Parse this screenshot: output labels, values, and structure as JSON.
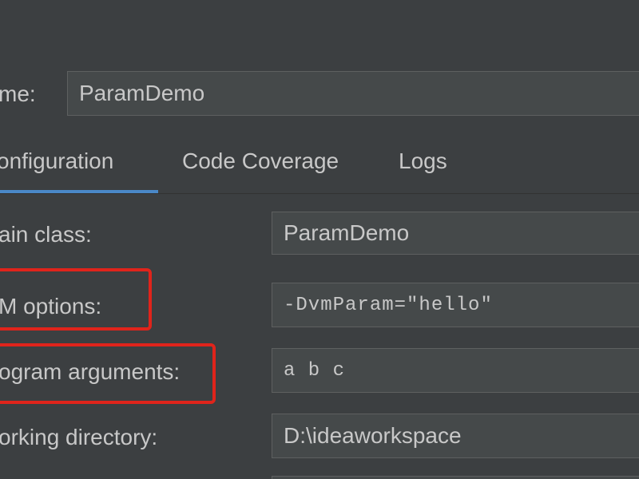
{
  "name_row": {
    "label": "me:",
    "value": "ParamDemo"
  },
  "tabs": [
    {
      "label": "onfiguration",
      "active": true
    },
    {
      "label": "Code Coverage",
      "active": false
    },
    {
      "label": "Logs",
      "active": false
    }
  ],
  "fields": {
    "main_class": {
      "label": "ain class:",
      "value": "ParamDemo"
    },
    "vm_options": {
      "label": "M options:",
      "value": "-DvmParam=\"hello\""
    },
    "program_arguments": {
      "label": "ogram arguments:",
      "value": "a b c"
    },
    "working_directory": {
      "label": "orking directory:",
      "value": "D:\\ideaworkspace"
    }
  },
  "colors": {
    "background": "#3c3f41",
    "field_background": "#45494a",
    "active_tab_underline": "#4a88c7",
    "highlight_box": "#e0241b"
  }
}
